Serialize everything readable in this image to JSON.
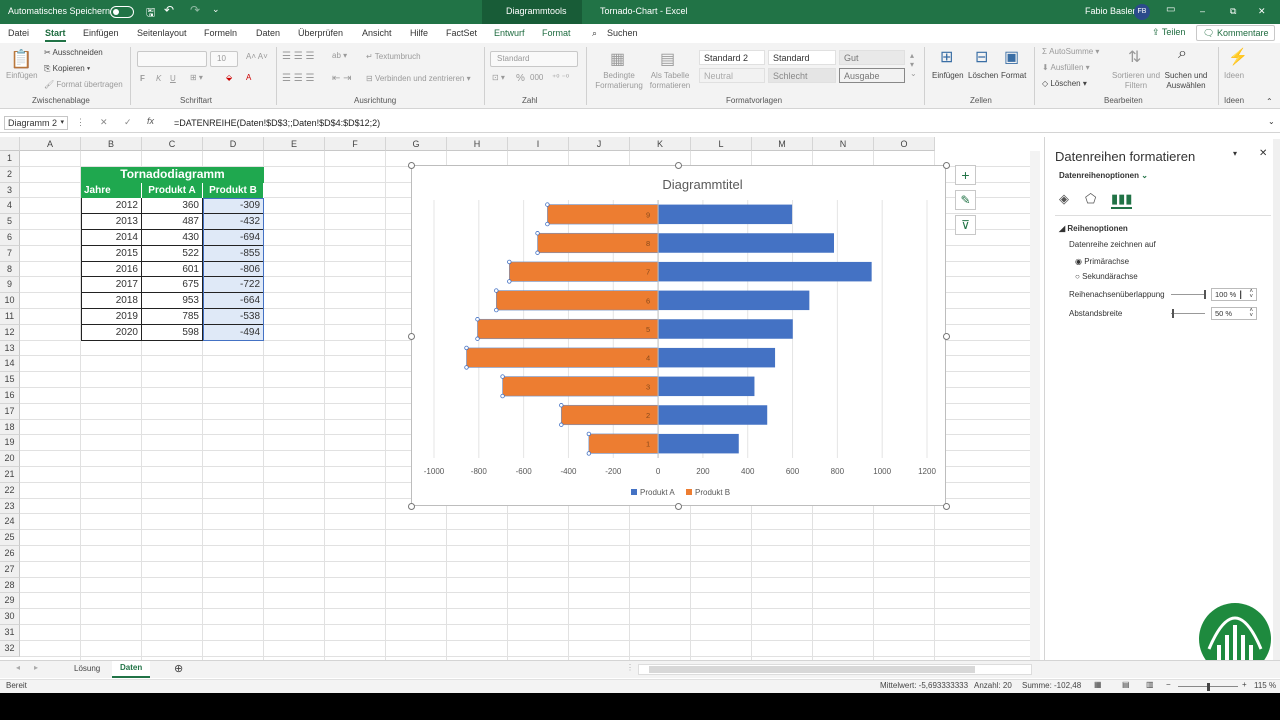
{
  "window": {
    "autosave_label": "Automatisches Speichern",
    "context_tab": "Diagrammtools",
    "title": "Tornado-Chart  -  Excel",
    "user": "Fabio Basler",
    "user_initials": "FB",
    "minimize": "–",
    "restore": "⧉",
    "close": "✕"
  },
  "ribbon_tabs": [
    "Datei",
    "Start",
    "Einfügen",
    "Seitenlayout",
    "Formeln",
    "Daten",
    "Überprüfen",
    "Ansicht",
    "Hilfe",
    "FactSet",
    "Entwurf",
    "Format"
  ],
  "search_label": "Suchen",
  "share_label": "Teilen",
  "comments_label": "Kommentare",
  "ribbon": {
    "clipboard": {
      "paste": "Einfügen",
      "cut": "Ausschneiden",
      "copy": "Kopieren",
      "format_painter": "Format übertragen",
      "group": "Zwischenablage"
    },
    "font": {
      "size": "10",
      "bold": "F",
      "italic": "K",
      "underline": "U",
      "group": "Schriftart"
    },
    "alignment": {
      "wrap": "Textumbruch",
      "merge": "Verbinden und zentrieren",
      "group": "Ausrichtung"
    },
    "number": {
      "format": "Standard",
      "percent": "%",
      "thousands": "000",
      "group": "Zahl"
    },
    "styles": {
      "conditional": "Bedingte Formatierung",
      "as_table": "Als Tabelle formatieren",
      "group": "Formatvorlagen",
      "boxes": [
        "Standard 2",
        "Standard",
        "Gut",
        "Neutral",
        "Schlecht",
        "Ausgabe"
      ]
    },
    "cells": {
      "insert": "Einfügen",
      "delete": "Löschen",
      "format": "Format",
      "group": "Zellen"
    },
    "editing": {
      "autosum": "AutoSumme",
      "fill": "Ausfüllen",
      "clear": "Löschen",
      "sort": "Sortieren und Filtern",
      "find": "Suchen und Auswählen",
      "group": "Bearbeiten"
    },
    "ideas": {
      "label": "Ideen",
      "group": "Ideen"
    }
  },
  "formula_bar": {
    "name_box": "Diagramm 2",
    "fx": "fx",
    "cancel": "✕",
    "confirm": "✓",
    "formula": "=DATENREIHE(Daten!$D$3;;Daten!$D$4:$D$12;2)"
  },
  "columns": [
    "A",
    "B",
    "C",
    "D",
    "E",
    "F",
    "G",
    "H",
    "I",
    "J",
    "K",
    "L",
    "M",
    "N",
    "O"
  ],
  "rows": [
    "1",
    "2",
    "3",
    "4",
    "5",
    "6",
    "7",
    "8",
    "9",
    "10",
    "11",
    "12",
    "13",
    "14",
    "15",
    "16",
    "17",
    "18",
    "19",
    "20",
    "21",
    "22",
    "23",
    "24",
    "25",
    "26",
    "27",
    "28",
    "29",
    "30",
    "31",
    "32"
  ],
  "table": {
    "title": "Tornadodiagramm",
    "headers": [
      "Jahre",
      "Produkt A",
      "Produkt B"
    ],
    "rows": [
      [
        "2012",
        "360",
        "-309"
      ],
      [
        "2013",
        "487",
        "-432"
      ],
      [
        "2014",
        "430",
        "-694"
      ],
      [
        "2015",
        "522",
        "-855"
      ],
      [
        "2016",
        "601",
        "-806"
      ],
      [
        "2017",
        "675",
        "-722"
      ],
      [
        "2018",
        "953",
        "-664"
      ],
      [
        "2019",
        "785",
        "-538"
      ],
      [
        "2020",
        "598",
        "-494"
      ]
    ]
  },
  "chart_data": {
    "type": "bar",
    "orientation": "horizontal",
    "title": "Diagrammtitel",
    "categories": [
      "1",
      "2",
      "3",
      "4",
      "5",
      "6",
      "7",
      "8",
      "9"
    ],
    "series": [
      {
        "name": "Produkt A",
        "color": "#4472c4",
        "values": [
          360,
          487,
          430,
          522,
          601,
          675,
          953,
          785,
          598
        ]
      },
      {
        "name": "Produkt B",
        "color": "#ed7d31",
        "values": [
          -309,
          -432,
          -694,
          -855,
          -806,
          -722,
          -664,
          -538,
          -494
        ]
      }
    ],
    "xlim": [
      -1000,
      1200
    ],
    "xticks": [
      "-1000",
      "-800",
      "-600",
      "-400",
      "-200",
      "0",
      "200",
      "400",
      "600",
      "800",
      "1000",
      "1200"
    ],
    "grid": true,
    "legend": "bottom"
  },
  "chart_buttons": {
    "add": "+",
    "style": "✎",
    "filter": "⊽"
  },
  "pane": {
    "title": "Datenreihen formatieren",
    "subtitle": "Datenreihenoptionen",
    "section": "Reihenoptionen",
    "plot_on": "Datenreihe zeichnen auf",
    "primary": "Primärachse",
    "secondary": "Sekundärachse",
    "overlap_label": "Reihenachsenüberlappung",
    "overlap_value": "100 %",
    "gap_label": "Abstandsbreite",
    "gap_value": "50 %",
    "close": "✕",
    "menu": "▾"
  },
  "sheets": [
    "Lösung",
    "Daten"
  ],
  "status": {
    "ready": "Bereit",
    "average": "Mittelwert: -5,693333333",
    "count": "Anzahl: 20",
    "sum": "Summe: -102,48",
    "zoom": "115 %"
  }
}
